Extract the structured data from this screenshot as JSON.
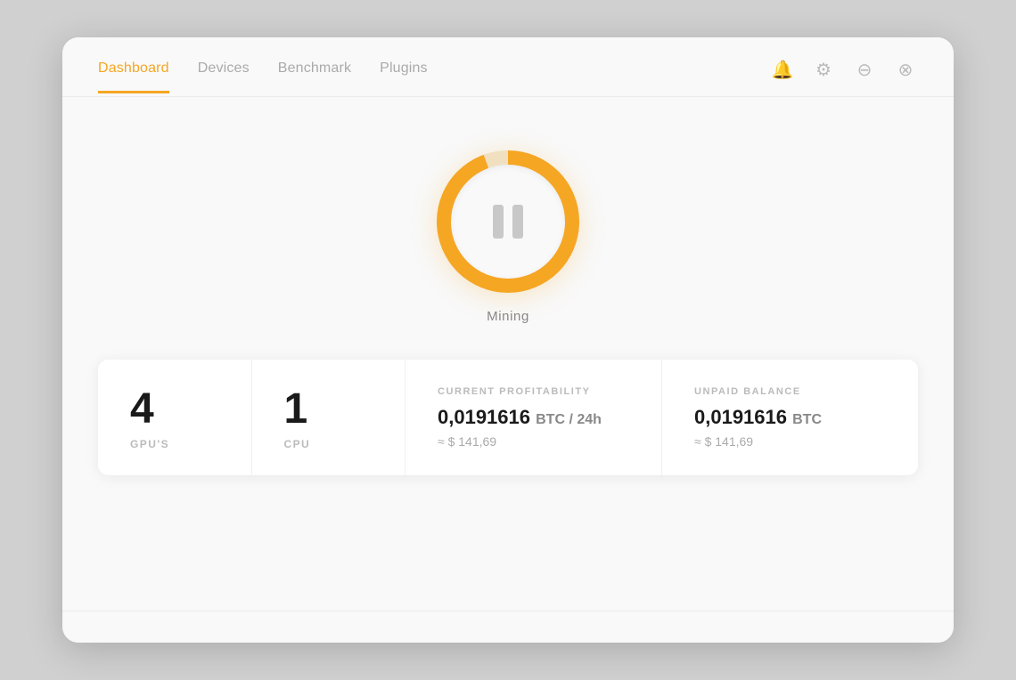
{
  "nav": {
    "items": [
      {
        "label": "Dashboard",
        "active": true
      },
      {
        "label": "Devices",
        "active": false
      },
      {
        "label": "Benchmark",
        "active": false
      },
      {
        "label": "Plugins",
        "active": false
      }
    ]
  },
  "icons": {
    "bell": "🔔",
    "gear": "⚙",
    "minimize": "⊖",
    "close": "⊗"
  },
  "mining": {
    "label": "Mining"
  },
  "stats": {
    "gpu_count": "4",
    "gpu_label": "GPU'S",
    "cpu_count": "1",
    "cpu_label": "CPU",
    "profitability": {
      "title": "CURRENT PROFITABILITY",
      "btc": "0,0191616",
      "unit": "BTC / 24h",
      "usd": "≈ $ 141,69"
    },
    "balance": {
      "title": "UNPAID BALANCE",
      "btc": "0,0191616",
      "unit": "BTC",
      "usd": "≈ $ 141,69"
    }
  }
}
